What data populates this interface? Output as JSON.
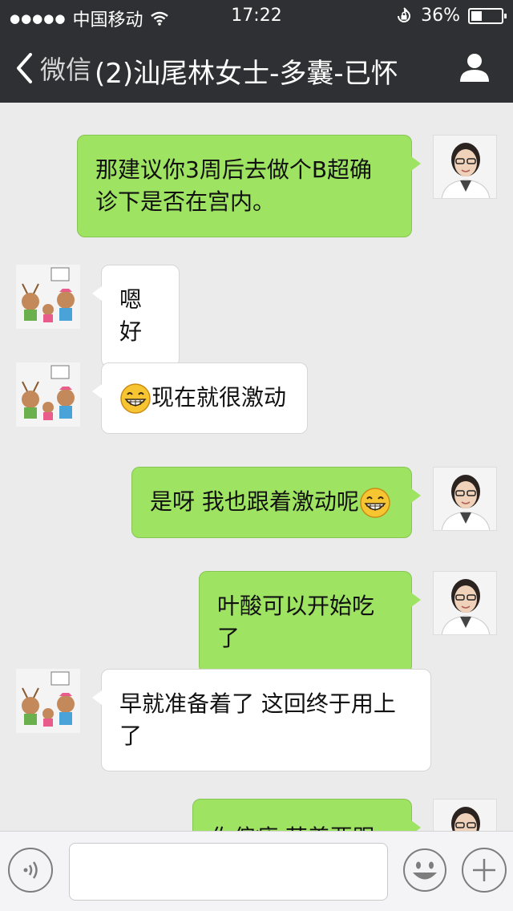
{
  "status_bar": {
    "signal": "●●●●●",
    "carrier": "中国移动",
    "time": "17:22",
    "battery_percent": "36%",
    "battery_level": 0.36
  },
  "nav_bar": {
    "back_label": "微信",
    "title": "(2)汕尾林女士-多囊-已怀"
  },
  "messages": [
    {
      "sender": "doctor",
      "text": "那建议你3周后去做个B超确诊下是否在宫内。"
    },
    {
      "sender": "patient",
      "text": "嗯好"
    },
    {
      "sender": "patient",
      "emoji": "grin-emoji",
      "text": "现在就很激动"
    },
    {
      "sender": "doctor",
      "text": "是呀 我也跟着激动呢",
      "emoji": "grin-emoji"
    },
    {
      "sender": "doctor",
      "text": "叶酸可以开始吃了"
    },
    {
      "sender": "patient",
      "text": "早就准备着了 这回终于用上了"
    },
    {
      "sender": "doctor",
      "text": "你偏瘦 营养要跟上"
    }
  ],
  "input_bar": {
    "icons": [
      "voice-icon",
      "emoji-icon",
      "plus-icon"
    ],
    "value": ""
  },
  "colors": {
    "bar_bg": "#2e3033",
    "chat_bg": "#ebebeb",
    "outgoing_bubble": "#9ee362",
    "incoming_bubble": "#ffffff"
  }
}
